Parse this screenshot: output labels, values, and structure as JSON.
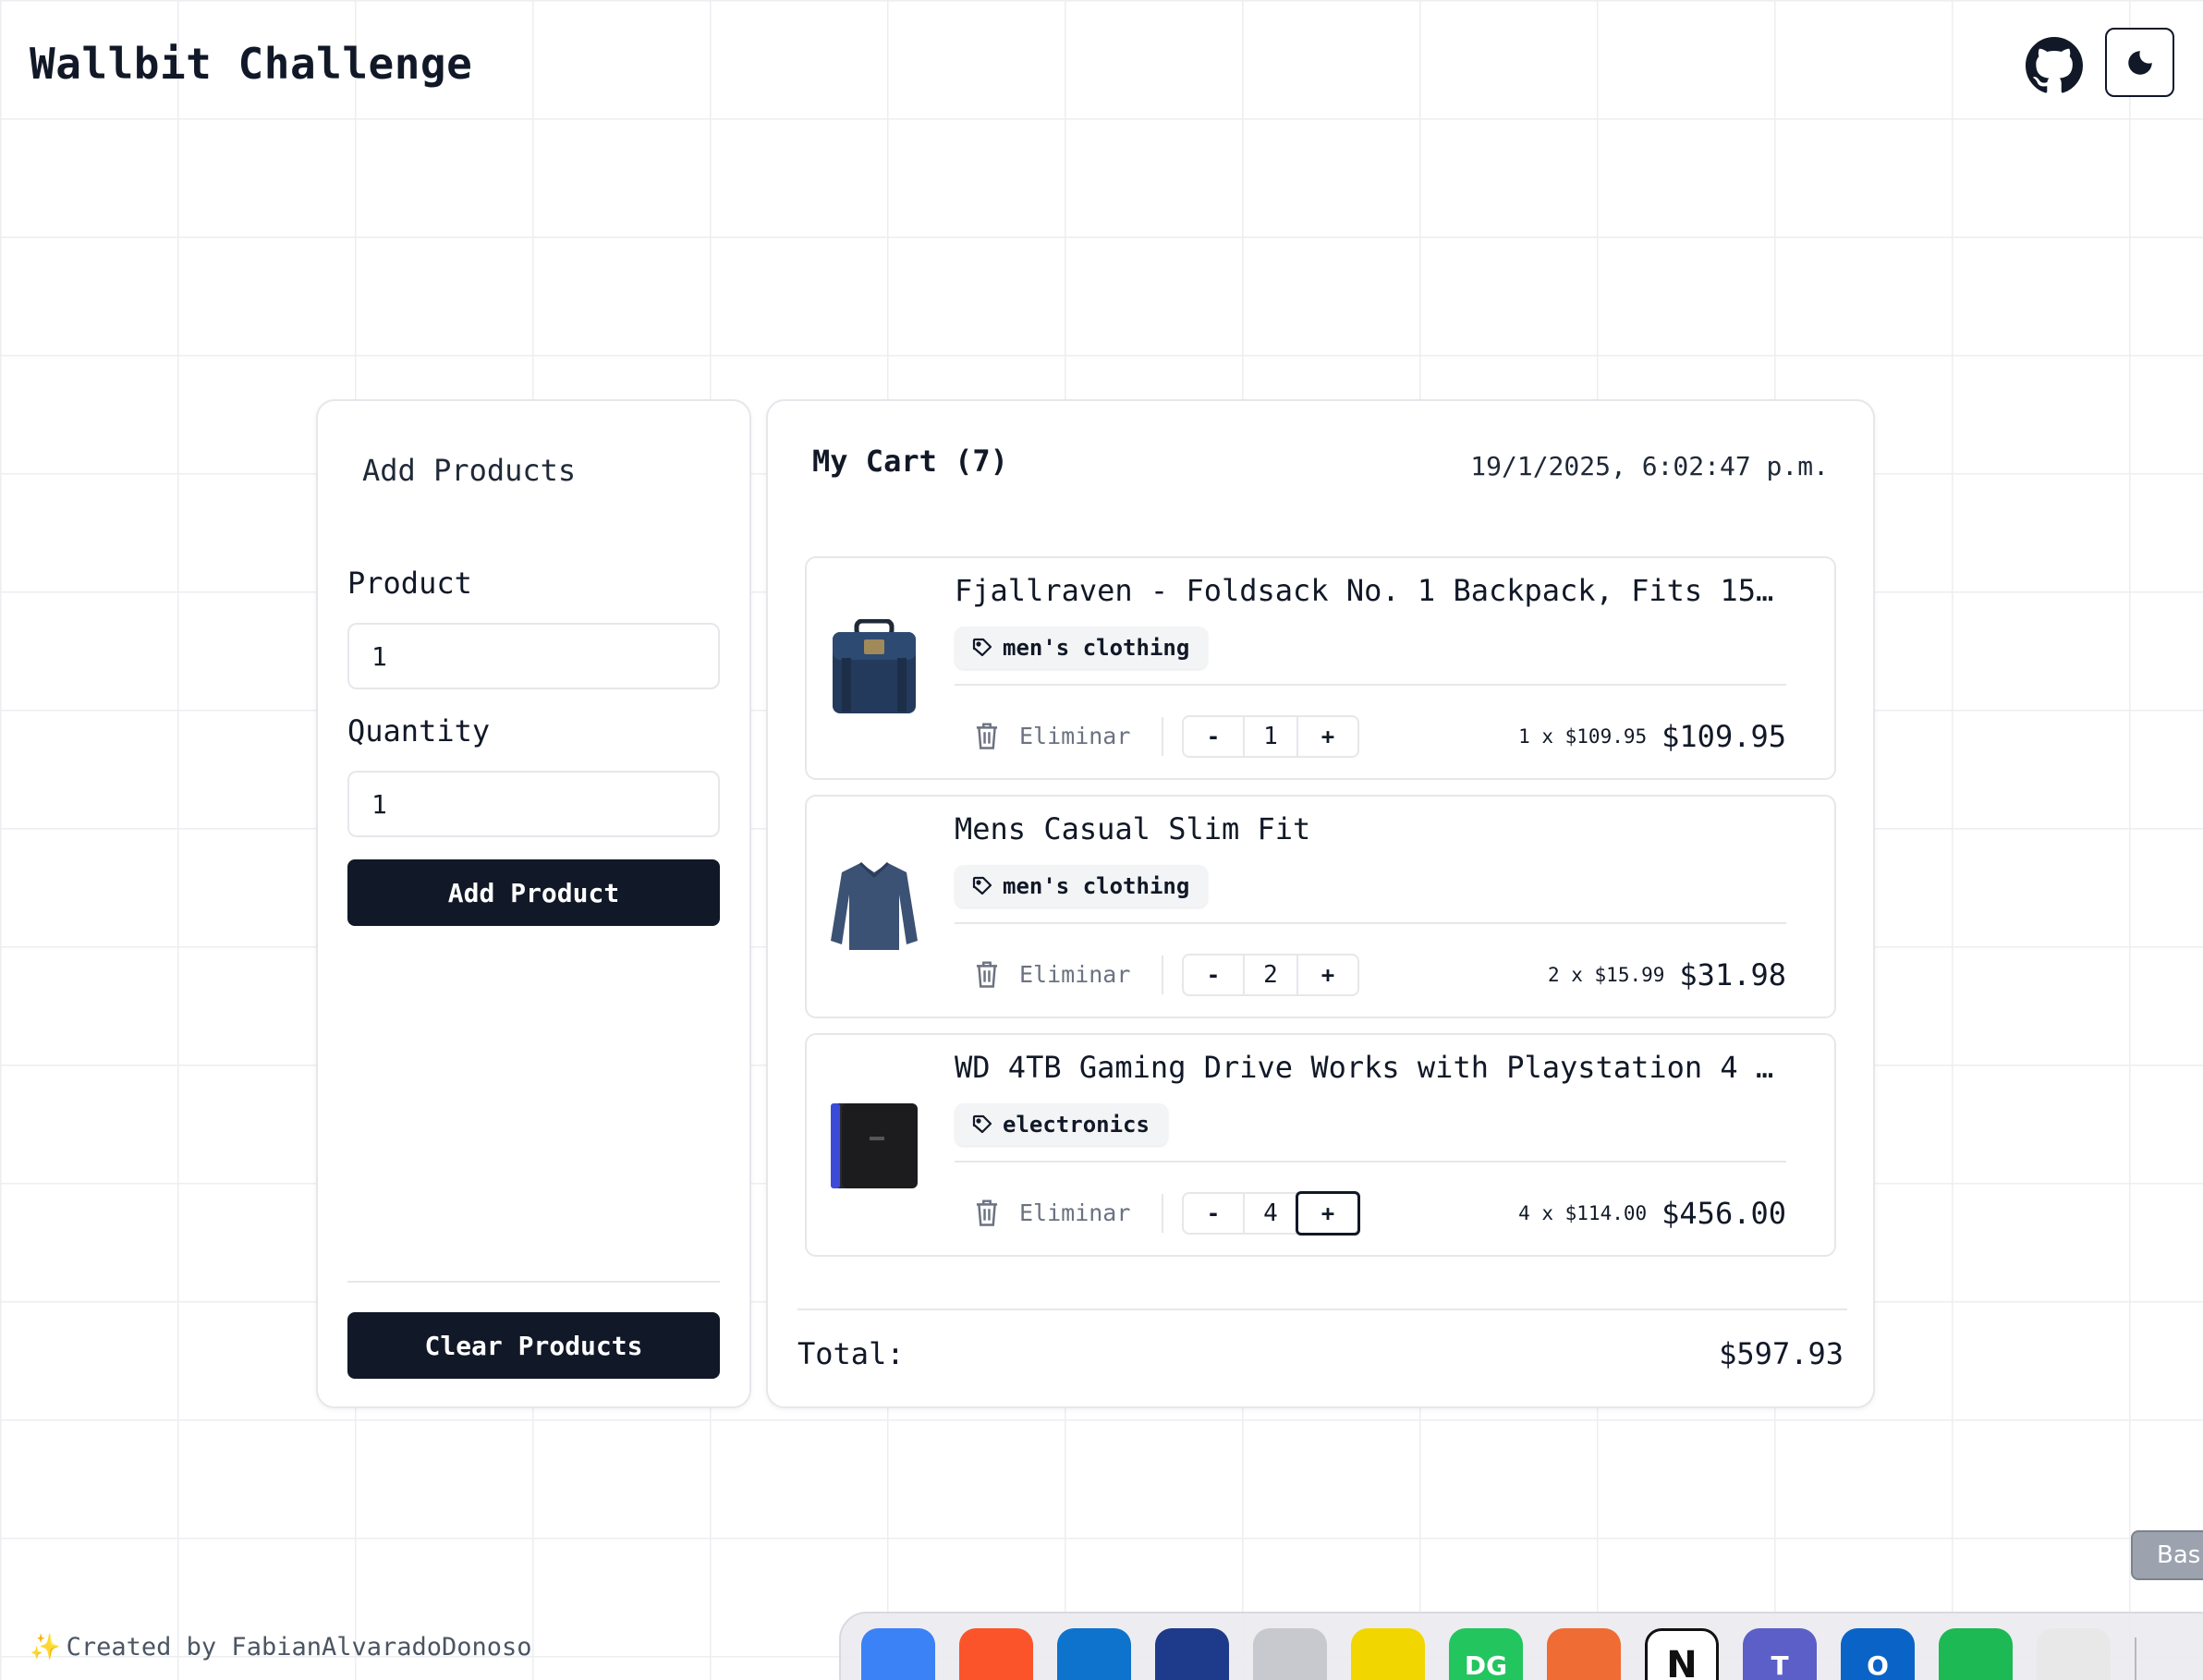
{
  "header": {
    "title": "Wallbit Challenge",
    "github_icon": "github-icon",
    "theme_icon": "moon-icon"
  },
  "add_products": {
    "title": "Add Products",
    "product_label": "Product",
    "product_value": "1",
    "quantity_label": "Quantity",
    "quantity_value": "1",
    "add_button": "Add Product",
    "clear_button": "Clear Products"
  },
  "cart": {
    "title": "My Cart (7)",
    "date": "19/1/2025, 6:02:47 p.m.",
    "remove_label": "Eliminar",
    "decrement": "-",
    "increment": "+",
    "items": [
      {
        "name": "Fjallraven - Foldsack No. 1 Backpack, Fits 15…",
        "category": "men's clothing",
        "quantity": "1",
        "unit_price": "1 x $109.95",
        "line_total": "$109.95",
        "image_icon": "backpack-image"
      },
      {
        "name": "Mens Casual Slim Fit",
        "category": "men's clothing",
        "quantity": "2",
        "unit_price": "2 x $15.99",
        "line_total": "$31.98",
        "image_icon": "shirt-image"
      },
      {
        "name": "WD 4TB Gaming Drive Works with Playstation 4 …",
        "category": "electronics",
        "quantity": "4",
        "unit_price": "4 x $114.00",
        "line_total": "$456.00",
        "image_icon": "hard-drive-image"
      }
    ],
    "total_label": "Total:",
    "total_value": "$597.93"
  },
  "footer": {
    "sparkle": "✨",
    "text": "Created by FabianAlvaradoDonoso"
  },
  "dock": {
    "tooltip": "Bas",
    "apps": [
      {
        "name": "finder",
        "color": "#3b82f6",
        "glyph": ""
      },
      {
        "name": "brave",
        "color": "#fb542b",
        "glyph": ""
      },
      {
        "name": "vscode",
        "color": "#0e73cc",
        "glyph": ""
      },
      {
        "name": "xcode-app",
        "color": "#1e3a8a",
        "glyph": ""
      },
      {
        "name": "iphone-mirroring",
        "color": "#c7c9ce",
        "glyph": ""
      },
      {
        "name": "js-app",
        "color": "#f2d600",
        "glyph": ""
      },
      {
        "name": "datagrip",
        "color": "#22c55e",
        "glyph": "DG"
      },
      {
        "name": "postman",
        "color": "#ef6c35",
        "glyph": ""
      },
      {
        "name": "notion",
        "color": "#ffffff",
        "glyph": "N"
      },
      {
        "name": "teams",
        "color": "#5b5fc7",
        "glyph": "T"
      },
      {
        "name": "outlook",
        "color": "#0a64c8",
        "glyph": "O"
      },
      {
        "name": "spotify",
        "color": "#1db954",
        "glyph": ""
      },
      {
        "name": "chrome",
        "color": "#e8e8e8",
        "glyph": ""
      }
    ]
  },
  "colors": {
    "primary": "#111827",
    "border": "#e5e7eb",
    "muted": "#6b7280"
  }
}
